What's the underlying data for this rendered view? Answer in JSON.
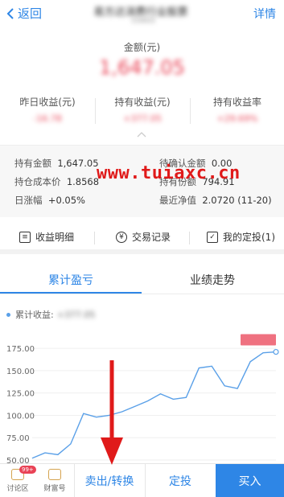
{
  "nav": {
    "back_label": "返回",
    "title": "易方达消费行业股票",
    "subtitle": "110022",
    "detail_label": "详情"
  },
  "amount": {
    "label": "金额(元)",
    "value": "1,647.05"
  },
  "stats": [
    {
      "label": "昨日收益(元)",
      "value": "-16.78"
    },
    {
      "label": "持有收益(元)",
      "value": "+377.05"
    },
    {
      "label": "持有收益率",
      "value": "+29.69%"
    }
  ],
  "info": {
    "hold_amount_label": "持有金额",
    "hold_amount": "1,647.05",
    "pending_label": "待确认金额",
    "pending": "0.00",
    "cost_label": "持仓成本价",
    "cost": "1.8568",
    "shares_label": "持有份额",
    "shares": "794.91",
    "daily_label": "日涨幅",
    "daily": "+0.05%",
    "nav_label": "最近净值",
    "nav": "2.0720 (11-20)"
  },
  "watermark": "www.tuiaxc.cn",
  "actions": [
    {
      "label": "收益明细",
      "icon": "document-icon"
    },
    {
      "label": "交易记录",
      "icon": "yen-icon"
    },
    {
      "label": "我的定投(1)",
      "icon": "calendar-icon"
    }
  ],
  "tabs": [
    {
      "label": "累计盈亏"
    },
    {
      "label": "业绩走势"
    }
  ],
  "chart_data": {
    "type": "line",
    "legend": "累计收益:",
    "legend_value": "+377.05",
    "y_ticks": [
      "175.00",
      "150.00",
      "125.00",
      "100.00",
      "75.00",
      "50.00"
    ],
    "ylim": [
      50,
      185
    ],
    "grid": true,
    "series": [
      {
        "name": "累计收益",
        "color": "#5aa0e8",
        "values": [
          52,
          58,
          56,
          68,
          102,
          98,
          100,
          104,
          110,
          116,
          124,
          118,
          120,
          153,
          155,
          133,
          130,
          160,
          170,
          171
        ]
      }
    ],
    "marker_label_color": "#e94255"
  },
  "bottom": {
    "forum_label": "讨论区",
    "forum_badge": "99+",
    "wealth_label": "财富号",
    "sell_label": "卖出/转换",
    "plan_label": "定投",
    "buy_label": "买入"
  },
  "colors": {
    "accent": "#2e86e6",
    "positive": "#e94255",
    "arrow": "#e01a1a"
  }
}
